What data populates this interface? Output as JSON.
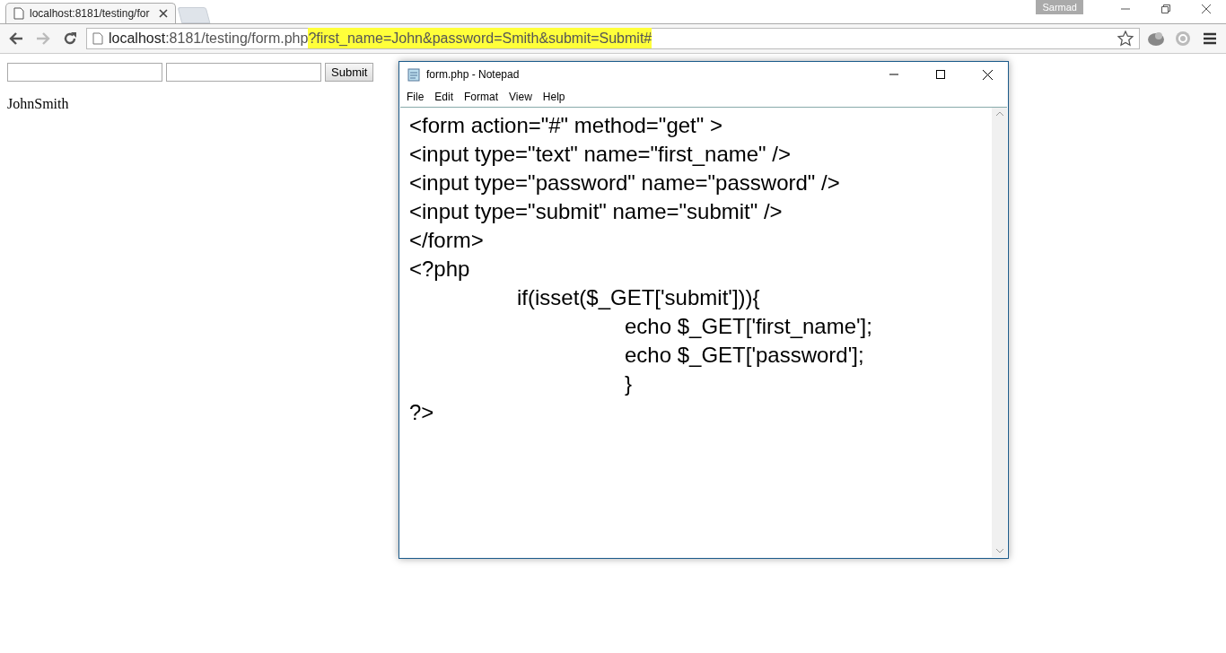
{
  "browser": {
    "tab": {
      "title": "localhost:8181/testing/for",
      "selected": true
    },
    "profile": "Sarmad",
    "url": {
      "host": "localhost",
      "path": ":8181/testing/form.php",
      "query": "?first_name=John&password=Smith&submit=Submit#"
    }
  },
  "page": {
    "submit": "Submit",
    "output": "JohnSmith"
  },
  "notepad": {
    "title": "form.php - Notepad",
    "menu": [
      "File",
      "Edit",
      "Format",
      "View",
      "Help"
    ],
    "lines": [
      "<form action=\"#\" method=\"get\" >",
      "<input type=\"text\" name=\"first_name\" />",
      "<input type=\"password\" name=\"password\" />",
      "<input type=\"submit\" name=\"submit\" />",
      "</form>",
      "<?php",
      "\tif(isset($_GET['submit'])){",
      "\t\techo $_GET['first_name'];",
      "\t\techo $_GET['password'];",
      "\t\t}",
      "?>"
    ]
  }
}
